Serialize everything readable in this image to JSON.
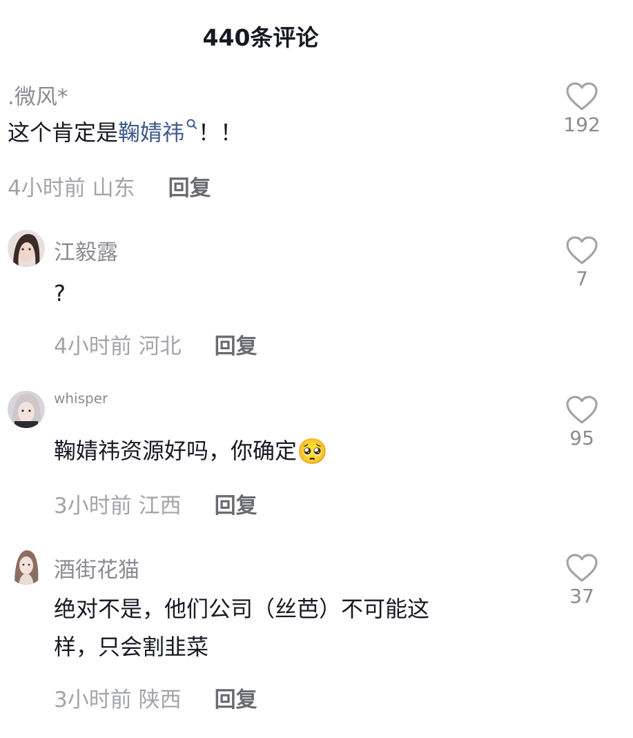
{
  "header": {
    "title": "440条评论"
  },
  "comments": [
    {
      "username": ".微风*",
      "text_prefix": "这个肯定是",
      "text_link": "鞠婧祎",
      "text_suffix": "！！",
      "time": "4小时前",
      "location": "山东",
      "reply_label": "回复",
      "likes": "192"
    },
    {
      "username": "江毅露",
      "text": "?",
      "time": "4小时前",
      "location": "河北",
      "reply_label": "回复",
      "likes": "7"
    },
    {
      "username": "whisper",
      "text": "鞠婧祎资源好吗，你确定",
      "emoji": "🥺",
      "time": "3小时前",
      "location": "江西",
      "reply_label": "回复",
      "likes": "95"
    },
    {
      "username": "酒街花猫",
      "text_line1": "绝对不是，他们公司（丝芭）不可能这",
      "text_line2": "样，只会割韭菜",
      "time": "3小时前",
      "location": "陕西",
      "reply_label": "回复",
      "likes": "37"
    }
  ],
  "icons": {
    "like": "heart-outline-icon",
    "search": "search-icon"
  },
  "colors": {
    "link": "#3e5a8a",
    "muted": "#a3a4a8",
    "text": "#161823"
  }
}
